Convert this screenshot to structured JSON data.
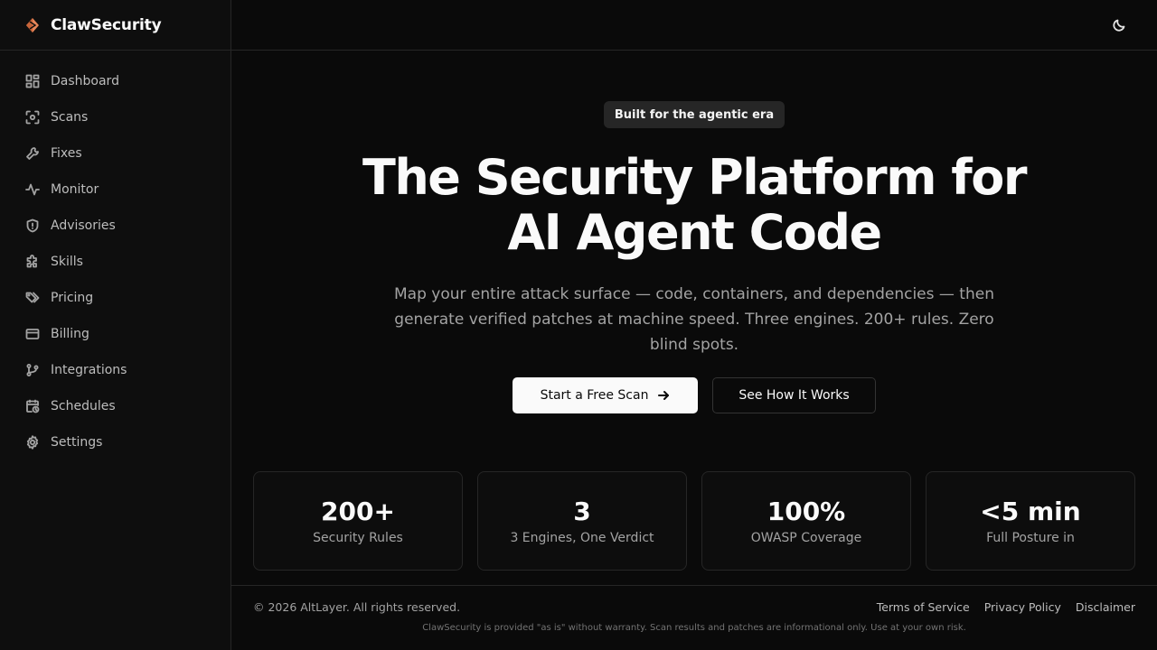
{
  "brand": {
    "name": "ClawSecurity",
    "logo_icon": "claw-logo-icon",
    "accent": "#e8875a"
  },
  "sidebar": {
    "items": [
      {
        "label": "Dashboard",
        "icon": "layout-grid-icon"
      },
      {
        "label": "Scans",
        "icon": "scan-icon"
      },
      {
        "label": "Fixes",
        "icon": "wrench-icon"
      },
      {
        "label": "Monitor",
        "icon": "activity-icon"
      },
      {
        "label": "Advisories",
        "icon": "shield-alert-icon"
      },
      {
        "label": "Skills",
        "icon": "puzzle-icon"
      },
      {
        "label": "Pricing",
        "icon": "tags-icon"
      },
      {
        "label": "Billing",
        "icon": "credit-card-icon"
      },
      {
        "label": "Integrations",
        "icon": "git-branch-icon"
      },
      {
        "label": "Schedules",
        "icon": "calendar-clock-icon"
      },
      {
        "label": "Settings",
        "icon": "gear-icon"
      }
    ]
  },
  "topbar": {
    "theme_icon": "moon-icon"
  },
  "hero": {
    "badge": "Built for the agentic era",
    "title_line1": "The Security Platform for",
    "title_line2": "AI Agent Code",
    "subtitle": "Map your entire attack surface — code, containers, and dependencies — then generate verified patches at machine speed. Three engines. 200+ rules. Zero blind spots.",
    "primary_cta": "Start a Free Scan",
    "secondary_cta": "See How It Works"
  },
  "stats": [
    {
      "value": "200+",
      "label": "Security Rules"
    },
    {
      "value": "3",
      "label": "3 Engines, One Verdict"
    },
    {
      "value": "100%",
      "label": "OWASP Coverage"
    },
    {
      "value": "<5 min",
      "label": "Full Posture in"
    }
  ],
  "footer": {
    "copyright": "© 2026 AltLayer. All rights reserved.",
    "links": [
      "Terms of Service",
      "Privacy Policy",
      "Disclaimer"
    ],
    "disclaimer": "ClawSecurity is provided \"as is\" without warranty. Scan results and patches are informational only. Use at your own risk."
  }
}
